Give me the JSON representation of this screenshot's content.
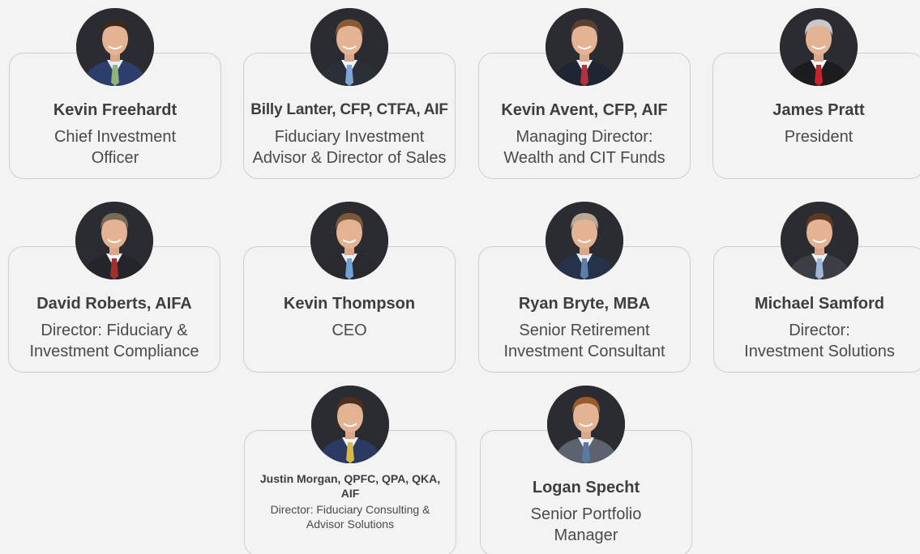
{
  "team": [
    {
      "name": "Kevin Freehardt",
      "title": "Chief Investment\nOfficer",
      "tie_color": "#8fb37d",
      "suit_color": "#2c3e6b",
      "shirt_color": "#e9eef6",
      "hair_color": "#3a2a20"
    },
    {
      "name": "Billy Lanter, CFP, CTFA, AIF",
      "title": "Fiduciary Investment\nAdvisor & Director of Sales",
      "tie_color": "#7fa6d6",
      "suit_color": "#2b2f38",
      "shirt_color": "#f2f4f8",
      "hair_color": "#8b5a35"
    },
    {
      "name": "Kevin Avent, CFP, AIF",
      "title": "Managing Director:\nWealth and CIT Funds",
      "tie_color": "#b33040",
      "suit_color": "#1f2533",
      "shirt_color": "#f4f4f4",
      "hair_color": "#5a4030"
    },
    {
      "name": "James Pratt",
      "title": "President",
      "tie_color": "#c8222a",
      "suit_color": "#1c1c1f",
      "shirt_color": "#f7f7f7",
      "hair_color": "#c8c8c8"
    },
    {
      "name": "David Roberts, AIFA",
      "title": "Director: Fiduciary &\nInvestment Compliance",
      "tie_color": "#a3312b",
      "suit_color": "#24252a",
      "shirt_color": "#f4f4f4",
      "hair_color": "#7a6a5a"
    },
    {
      "name": "Kevin Thompson",
      "title": "CEO",
      "tie_color": "#6fa3d8",
      "suit_color": "#2a2a2e",
      "shirt_color": "#eef2f7",
      "hair_color": "#7a5a3a"
    },
    {
      "name": "Ryan Bryte, MBA",
      "title": "Senior Retirement\nInvestment Consultant",
      "tie_color": "#5c7fa8",
      "suit_color": "#26324a",
      "shirt_color": "#e8eef6",
      "hair_color": "#b8a898"
    },
    {
      "name": "Michael Samford",
      "title": "Director:\nInvestment Solutions",
      "tie_color": "#9fb8d8",
      "suit_color": "#3b3e45",
      "shirt_color": "#f0f2f6",
      "hair_color": "#5a3a22"
    },
    {
      "name": "Justin Morgan, QPFC, QPA, QKA, AIF",
      "title": "Director: Fiduciary Consulting &\nAdvisor Solutions",
      "tie_color": "#d8b94a",
      "suit_color": "#2a3a63",
      "shirt_color": "#f4f4f4",
      "hair_color": "#4a3020"
    },
    {
      "name": "Logan Specht",
      "title": "Senior Portfolio\nManager",
      "tie_color": "#5a7aa3",
      "suit_color": "#5c636e",
      "shirt_color": "#f0f2f6",
      "hair_color": "#9a5a2a"
    }
  ]
}
